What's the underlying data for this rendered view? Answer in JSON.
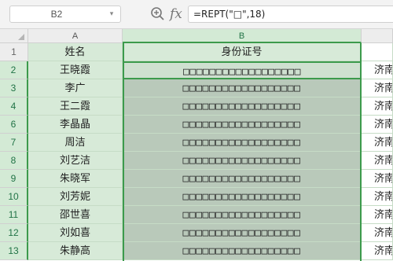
{
  "formula_bar": {
    "name_box": "B2",
    "fx_label": "fx",
    "formula": "=REPT(\"□\",18)"
  },
  "columns": [
    "A",
    "B"
  ],
  "rows": [
    {
      "num": "1",
      "a": "姓名",
      "b": "身份证号",
      "c": ""
    },
    {
      "num": "2",
      "a": "王晓霞",
      "b": "□□□□□□□□□□□□□□□□□□",
      "c": "济南"
    },
    {
      "num": "3",
      "a": "李广",
      "b": "□□□□□□□□□□□□□□□□□□",
      "c": "济南"
    },
    {
      "num": "4",
      "a": "王二霞",
      "b": "□□□□□□□□□□□□□□□□□□",
      "c": "济南"
    },
    {
      "num": "6",
      "a": "李晶晶",
      "b": "□□□□□□□□□□□□□□□□□□",
      "c": "济南"
    },
    {
      "num": "7",
      "a": "周洁",
      "b": "□□□□□□□□□□□□□□□□□□",
      "c": "济南"
    },
    {
      "num": "8",
      "a": "刘艺洁",
      "b": "□□□□□□□□□□□□□□□□□□",
      "c": "济南"
    },
    {
      "num": "9",
      "a": "朱晓军",
      "b": "□□□□□□□□□□□□□□□□□□",
      "c": "济南"
    },
    {
      "num": "10",
      "a": "刘芳妮",
      "b": "□□□□□□□□□□□□□□□□□□",
      "c": "济南"
    },
    {
      "num": "11",
      "a": "邵世喜",
      "b": "□□□□□□□□□□□□□□□□□□",
      "c": "济南"
    },
    {
      "num": "12",
      "a": "刘如喜",
      "b": "□□□□□□□□□□□□□□□□□□",
      "c": "济南"
    },
    {
      "num": "13",
      "a": "朱静高",
      "b": "□□□□□□□□□□□□□□□□□□",
      "c": "济南"
    }
  ],
  "colors": {
    "selection": "#3c9a4c",
    "selected_fill": "#b9c9ba",
    "header_fill": "#d7ead8"
  }
}
